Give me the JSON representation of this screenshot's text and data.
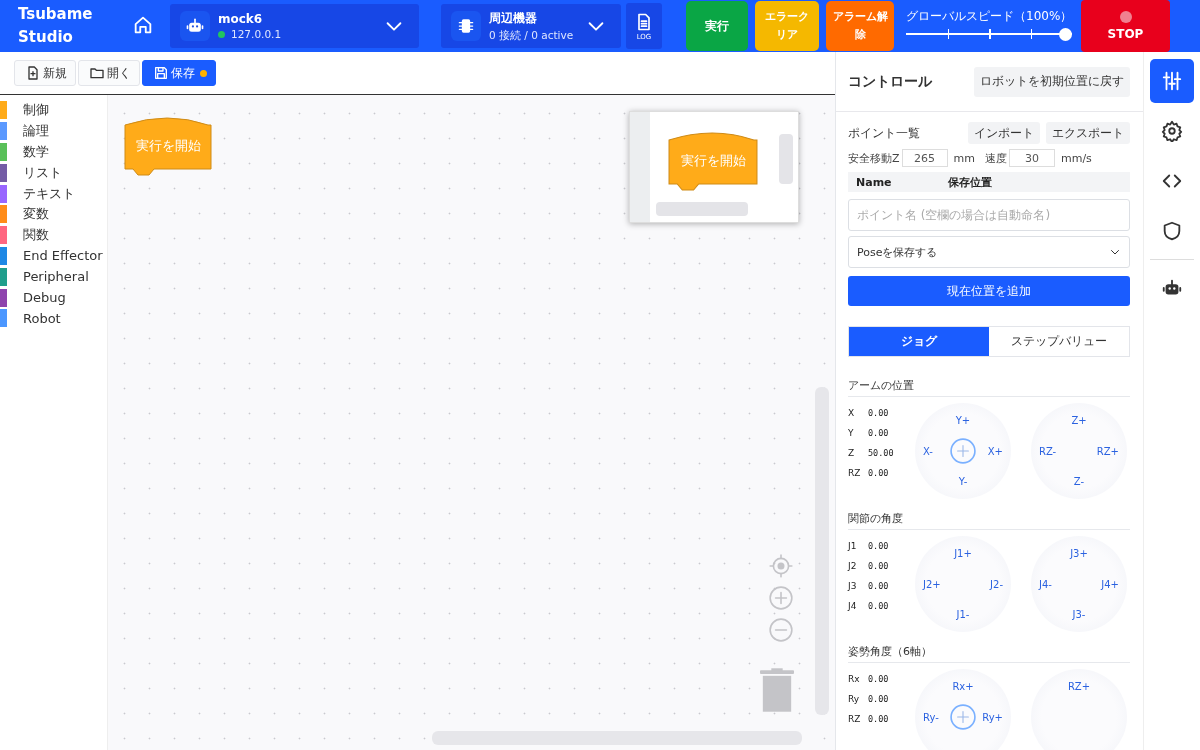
{
  "header": {
    "brand": "Tsubame Studio",
    "robot": {
      "name": "mock6",
      "address": "127.0.0.1",
      "connected": true
    },
    "peripheral": {
      "title": "周辺機器",
      "status": "0 接続 / 0 active"
    },
    "log": "LOG",
    "actions": [
      {
        "label": "実行",
        "kind": "run"
      },
      {
        "label": "エラークリア",
        "kind": "clear"
      },
      {
        "label": "アラーム解除",
        "kind": "alarm"
      }
    ],
    "speed": {
      "label": "グローバルスピード（100%）",
      "level": 1
    },
    "stop": "STOP"
  },
  "toolbar": [
    {
      "label": "新規",
      "kind": "new",
      "dirty": false
    },
    {
      "label": "開く",
      "kind": "open",
      "dirty": false
    },
    {
      "label": "保存",
      "kind": "save",
      "dirty": true
    }
  ],
  "categories": [
    {
      "label": "制御",
      "color": "#ffab19"
    },
    {
      "label": "論理",
      "color": "#5b99ff"
    },
    {
      "label": "数学",
      "color": "#59c059"
    },
    {
      "label": "リスト",
      "color": "#745ca6"
    },
    {
      "label": "テキスト",
      "color": "#9966ff"
    },
    {
      "label": "変数",
      "color": "#ff8c1a"
    },
    {
      "label": "関数",
      "color": "#ff6680"
    },
    {
      "label": "End Effector",
      "color": "#1e88e5"
    },
    {
      "label": "Peripheral",
      "color": "#1f9e8c"
    },
    {
      "label": "Debug",
      "color": "#8e44ad"
    },
    {
      "label": "Robot",
      "color": "#4c97ff"
    }
  ],
  "canvas": {
    "block": "実行を開始",
    "minimap_block": "実行を開始"
  },
  "control": {
    "title": "コントロール",
    "reset_button": "ロボットを初期位置に戻す",
    "points": {
      "title": "ポイント一覧",
      "import": "インポート",
      "export": "エクスポート",
      "safe_z": {
        "label": "安全移動Z",
        "value": "265",
        "unit": "mm"
      },
      "speed": {
        "label": "速度",
        "value": "30",
        "unit": "mm/s"
      },
      "columns": [
        "Name",
        "保存位置"
      ],
      "name_field": {
        "placeholder": "ポイント名 (空欄の場合は自動命名)"
      },
      "pose_select": "Poseを保存する",
      "add_button": "現在位置を追加"
    },
    "mode_tabs": [
      {
        "label": "ジョグ",
        "selected": true
      },
      {
        "label": "ステップバリュー",
        "selected": false
      }
    ],
    "sections": [
      {
        "title": "アームの位置",
        "readouts": [
          {
            "axis": "X",
            "value": "0.00"
          },
          {
            "axis": "Y",
            "value": "0.00"
          },
          {
            "axis": "Z",
            "value": "50.00"
          },
          {
            "axis": "RZ",
            "value": "0.00"
          }
        ],
        "pads": [
          {
            "up": "Y+",
            "left": "X-",
            "right": "X+",
            "down": "Y-",
            "center": true
          },
          {
            "up": "Z+",
            "left": "RZ-",
            "right": "RZ+",
            "down": "Z-",
            "center": false
          }
        ]
      },
      {
        "title": "関節の角度",
        "readouts": [
          {
            "axis": "J1",
            "value": "0.00"
          },
          {
            "axis": "J2",
            "value": "0.00"
          },
          {
            "axis": "J3",
            "value": "0.00"
          },
          {
            "axis": "J4",
            "value": "0.00"
          }
        ],
        "pads": [
          {
            "up": "J1+",
            "left": "J2+",
            "right": "J2-",
            "down": "J1-",
            "center": false
          },
          {
            "up": "J3+",
            "left": "J4-",
            "right": "J4+",
            "down": "J3-",
            "center": false
          }
        ]
      },
      {
        "title": "姿勢角度（6軸）",
        "readouts": [
          {
            "axis": "Rx",
            "value": "0.00"
          },
          {
            "axis": "Ry",
            "value": "0.00"
          },
          {
            "axis": "RZ",
            "value": "0.00"
          }
        ],
        "pads": [
          {
            "up": "Rx+",
            "left": "Ry-",
            "right": "Ry+",
            "center": true
          },
          {
            "up": "RZ+",
            "center": false
          }
        ]
      }
    ]
  },
  "rail": [
    {
      "kind": "sliders",
      "selected": true
    },
    {
      "kind": "gear",
      "selected": false
    },
    {
      "kind": "code",
      "selected": false
    },
    {
      "kind": "shield",
      "selected": false
    },
    {
      "kind": "robot",
      "selected": false
    }
  ]
}
